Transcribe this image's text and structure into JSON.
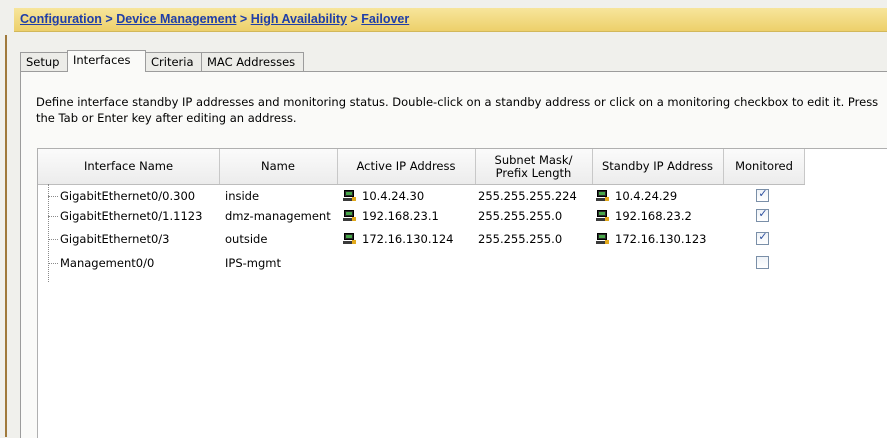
{
  "breadcrumb": {
    "items": [
      "Configuration",
      "Device Management",
      "High Availability",
      "Failover"
    ],
    "separator": ">"
  },
  "tabs": [
    {
      "label": "Setup",
      "active": false
    },
    {
      "label": "Interfaces",
      "active": true
    },
    {
      "label": "Criteria",
      "active": false
    },
    {
      "label": "MAC Addresses",
      "active": false
    }
  ],
  "description": "Define interface standby IP addresses and monitoring status. Double-click on a standby address or click on a monitoring checkbox to edit it. Press\nthe Tab or Enter key after editing an address.",
  "table": {
    "columns": [
      "Interface Name",
      "Name",
      "Active IP Address",
      "Subnet Mask/\nPrefix Length",
      "Standby IP Address",
      "Monitored"
    ],
    "rows": [
      {
        "interface": "GigabitEthernet0/0.300",
        "name": "inside",
        "active_ip": "10.4.24.30",
        "mask": "255.255.255.224",
        "standby_ip": "10.4.24.29",
        "monitored": true
      },
      {
        "interface": "GigabitEthernet0/1.1123",
        "name": "dmz-management",
        "active_ip": "192.168.23.1",
        "mask": "255.255.255.0",
        "standby_ip": "192.168.23.2",
        "monitored": true
      },
      {
        "interface": "GigabitEthernet0/3",
        "name": "outside",
        "active_ip": "172.16.130.124",
        "mask": "255.255.255.0",
        "standby_ip": "172.16.130.123",
        "monitored": true
      },
      {
        "interface": "Management0/0",
        "name": "IPS-mgmt",
        "active_ip": "",
        "mask": "",
        "standby_ip": "",
        "monitored": false
      }
    ]
  },
  "icons": {
    "ip_address": "network-host-icon",
    "checked": "checkmark-icon"
  }
}
